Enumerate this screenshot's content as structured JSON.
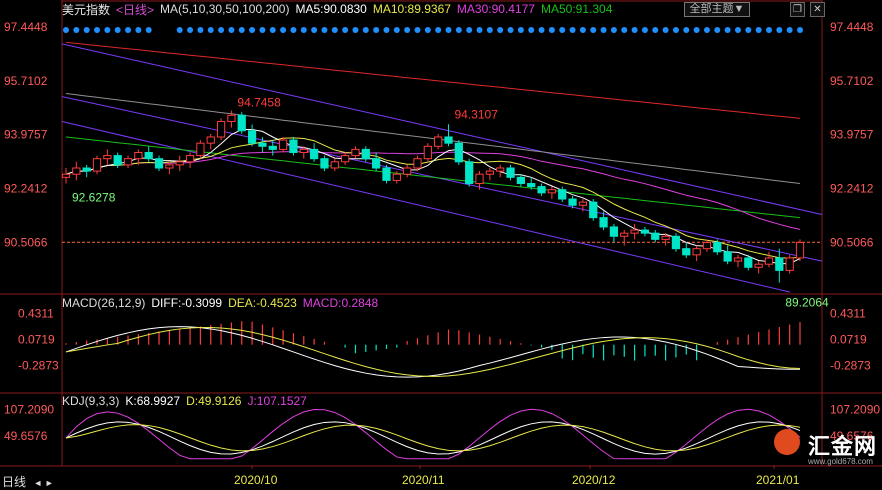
{
  "title": {
    "name": "美元指数",
    "period": "<日线>",
    "ma_label": "MA(5,10,30,50,100,200)",
    "ma5": "MA5:90.0830",
    "ma10": "MA10:89.9367",
    "ma30": "MA30:90.4177",
    "ma50": "MA50:91.304"
  },
  "toolbar": {
    "theme_label": "全部主题",
    "arrow_down": "▼"
  },
  "window": {
    "restore": "❐",
    "close": "✕"
  },
  "macd": {
    "label": "MACD(26,12,9)",
    "diff": "DIFF:-0.3099",
    "dea": "DEA:-0.4523",
    "macd": "MACD:0.2848"
  },
  "kdj": {
    "label": "KDJ(9,3,3)",
    "k": "K:68.9927",
    "d": "D:49.9126",
    "j": "J:107.1527"
  },
  "bottom": {
    "period_label": "日线",
    "arrows": "◄ ►"
  },
  "logo": {
    "name": "汇金网",
    "url": "www.gold678.com"
  },
  "colors": {
    "up": "#ff3c3c",
    "down": "#00e5c8",
    "ma5": "#ffffff",
    "ma10": "#e8e84a",
    "ma30": "#e040e0",
    "ma50": "#18c018",
    "ma100": "#909090",
    "ma200": "#e02828",
    "channel": "#7a3cff",
    "dot": "#1e90ff",
    "price_line": "#ff6a3c"
  },
  "chart_data": [
    {
      "type": "candlestick",
      "title": "美元指数 <日线>",
      "y_ticks": [
        "97.4448",
        "95.7102",
        "93.9757",
        "92.2412",
        "90.5066"
      ],
      "x_ticks": [
        "2020/10",
        "2020/11",
        "2020/12",
        "2021/01"
      ],
      "current_price": 90.5066,
      "annotations": [
        {
          "label": "94.7458",
          "date": "2020-09-25"
        },
        {
          "label": "94.3107",
          "date": "2020-11-04"
        },
        {
          "label": "92.6278",
          "date": "2020-09-01"
        },
        {
          "label": "89.2064",
          "date": "2021-01-06"
        }
      ],
      "ma_periods": [
        5,
        10,
        30,
        50,
        100,
        200
      ],
      "ma_last": {
        "MA5": 90.083,
        "MA10": 89.9367,
        "MA30": 90.4177,
        "MA50": 91.304
      },
      "ohlc": [
        [
          92.6,
          92.9,
          92.4,
          92.7
        ],
        [
          92.7,
          93.1,
          92.5,
          92.9
        ],
        [
          92.9,
          93.0,
          92.6,
          92.8
        ],
        [
          92.8,
          93.3,
          92.7,
          93.2
        ],
        [
          93.2,
          93.5,
          93.0,
          93.3
        ],
        [
          93.3,
          93.4,
          92.9,
          93.0
        ],
        [
          93.0,
          93.3,
          92.9,
          93.2
        ],
        [
          93.2,
          93.5,
          93.0,
          93.4
        ],
        [
          93.4,
          93.6,
          93.1,
          93.2
        ],
        [
          93.2,
          93.3,
          92.8,
          92.9
        ],
        [
          92.9,
          93.1,
          92.7,
          93.0
        ],
        [
          93.0,
          93.3,
          92.8,
          93.1
        ],
        [
          93.1,
          93.4,
          92.9,
          93.3
        ],
        [
          93.3,
          93.8,
          93.2,
          93.7
        ],
        [
          93.7,
          94.0,
          93.5,
          93.9
        ],
        [
          93.9,
          94.5,
          93.8,
          94.4
        ],
        [
          94.4,
          94.75,
          94.2,
          94.6
        ],
        [
          94.6,
          94.7,
          94.0,
          94.1
        ],
        [
          94.1,
          94.3,
          93.6,
          93.7
        ],
        [
          93.7,
          93.9,
          93.4,
          93.6
        ],
        [
          93.6,
          93.8,
          93.3,
          93.5
        ],
        [
          93.5,
          93.9,
          93.4,
          93.8
        ],
        [
          93.8,
          93.9,
          93.3,
          93.4
        ],
        [
          93.4,
          93.6,
          93.2,
          93.5
        ],
        [
          93.5,
          93.7,
          93.1,
          93.2
        ],
        [
          93.2,
          93.3,
          92.8,
          92.9
        ],
        [
          92.9,
          93.2,
          92.8,
          93.1
        ],
        [
          93.1,
          93.4,
          93.0,
          93.3
        ],
        [
          93.3,
          93.6,
          93.2,
          93.5
        ],
        [
          93.5,
          93.6,
          93.1,
          93.2
        ],
        [
          93.2,
          93.4,
          92.8,
          92.9
        ],
        [
          92.9,
          93.0,
          92.4,
          92.5
        ],
        [
          92.5,
          92.8,
          92.4,
          92.7
        ],
        [
          92.7,
          93.0,
          92.6,
          92.9
        ],
        [
          92.9,
          93.3,
          92.8,
          93.2
        ],
        [
          93.2,
          93.7,
          93.1,
          93.6
        ],
        [
          93.6,
          94.0,
          93.5,
          93.9
        ],
        [
          93.9,
          94.31,
          93.6,
          93.7
        ],
        [
          93.7,
          93.8,
          93.0,
          93.1
        ],
        [
          93.1,
          93.2,
          92.3,
          92.4
        ],
        [
          92.4,
          92.8,
          92.2,
          92.7
        ],
        [
          92.7,
          92.9,
          92.5,
          92.8
        ],
        [
          92.8,
          93.0,
          92.6,
          92.9
        ],
        [
          92.9,
          93.0,
          92.5,
          92.6
        ],
        [
          92.6,
          92.7,
          92.3,
          92.4
        ],
        [
          92.4,
          92.6,
          92.2,
          92.3
        ],
        [
          92.3,
          92.4,
          92.0,
          92.1
        ],
        [
          92.1,
          92.3,
          91.9,
          92.2
        ],
        [
          92.2,
          92.3,
          91.8,
          91.9
        ],
        [
          91.9,
          92.0,
          91.6,
          91.7
        ],
        [
          91.7,
          91.9,
          91.5,
          91.8
        ],
        [
          91.8,
          91.9,
          91.2,
          91.3
        ],
        [
          91.3,
          91.5,
          90.9,
          91.0
        ],
        [
          91.0,
          91.1,
          90.5,
          90.7
        ],
        [
          90.7,
          90.9,
          90.4,
          90.8
        ],
        [
          90.8,
          91.1,
          90.6,
          90.9
        ],
        [
          90.9,
          91.0,
          90.7,
          90.8
        ],
        [
          90.8,
          90.9,
          90.5,
          90.6
        ],
        [
          90.6,
          90.8,
          90.4,
          90.7
        ],
        [
          90.7,
          90.8,
          90.2,
          90.3
        ],
        [
          90.3,
          90.5,
          90.0,
          90.1
        ],
        [
          90.1,
          90.4,
          89.9,
          90.3
        ],
        [
          90.3,
          90.6,
          90.2,
          90.5
        ],
        [
          90.5,
          90.6,
          90.1,
          90.2
        ],
        [
          90.2,
          90.4,
          89.8,
          89.9
        ],
        [
          89.9,
          90.1,
          89.7,
          90.0
        ],
        [
          90.0,
          90.1,
          89.6,
          89.7
        ],
        [
          89.7,
          89.9,
          89.5,
          89.8
        ],
        [
          89.8,
          90.2,
          89.7,
          90.0
        ],
        [
          90.0,
          90.3,
          89.206,
          89.6
        ],
        [
          89.6,
          90.1,
          89.5,
          90.0
        ],
        [
          90.0,
          90.6,
          89.9,
          90.5
        ]
      ]
    },
    {
      "type": "line",
      "title": "MACD(26,12,9)",
      "y_ticks": [
        "0.4311",
        "0.0719",
        "-0.2873"
      ],
      "series": [
        {
          "name": "DIFF",
          "last": -0.3099
        },
        {
          "name": "DEA",
          "last": -0.4523
        },
        {
          "name": "MACD",
          "last": 0.2848
        }
      ]
    },
    {
      "type": "line",
      "title": "KDJ(9,3,3)",
      "y_ticks": [
        "107.2090",
        "49.6576"
      ],
      "series": [
        {
          "name": "K",
          "last": 68.9927
        },
        {
          "name": "D",
          "last": 49.9126
        },
        {
          "name": "J",
          "last": 107.1527
        }
      ]
    }
  ]
}
